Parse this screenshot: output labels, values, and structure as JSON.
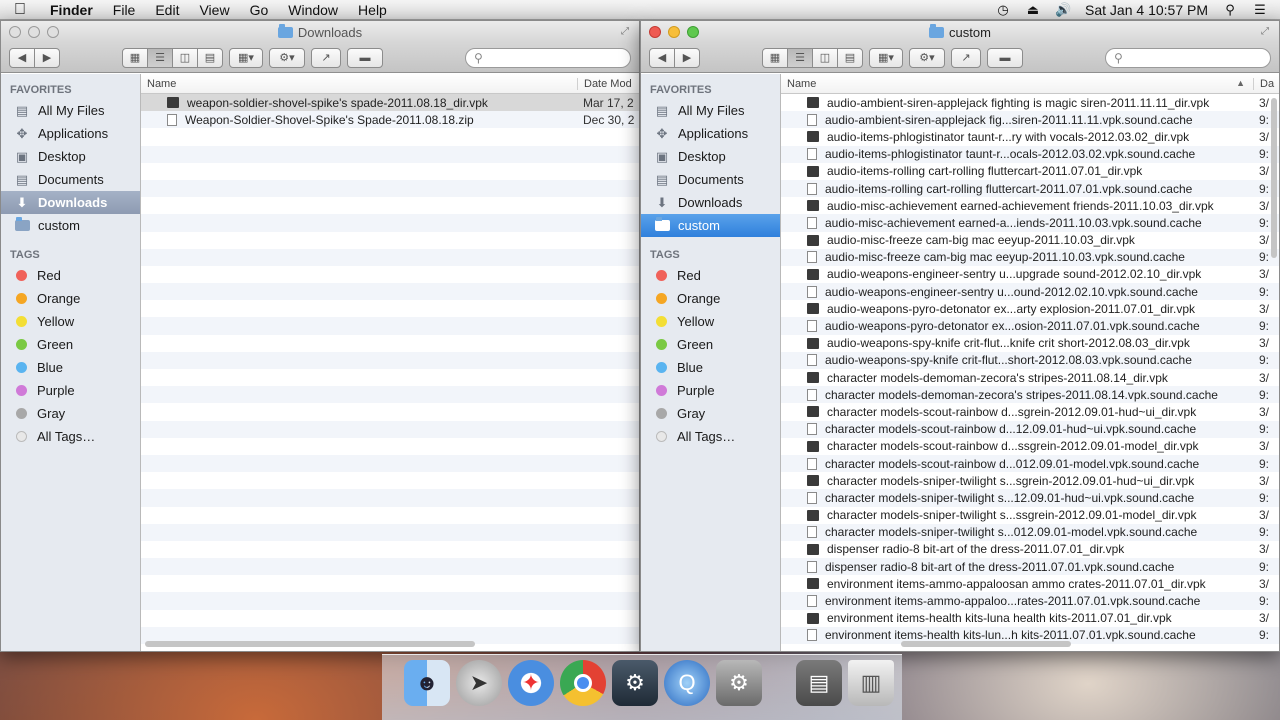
{
  "menubar": {
    "app": "Finder",
    "items": [
      "File",
      "Edit",
      "View",
      "Go",
      "Window",
      "Help"
    ],
    "clock": "Sat Jan 4  10:57 PM"
  },
  "left_window": {
    "title": "Downloads",
    "columns": {
      "name": "Name",
      "date": "Date Mod"
    },
    "sidebar": {
      "favorites_header": "FAVORITES",
      "favorites": [
        {
          "label": "All My Files",
          "icon": "all-files-icon"
        },
        {
          "label": "Applications",
          "icon": "applications-icon"
        },
        {
          "label": "Desktop",
          "icon": "desktop-icon"
        },
        {
          "label": "Documents",
          "icon": "documents-icon"
        },
        {
          "label": "Downloads",
          "icon": "downloads-icon"
        },
        {
          "label": "custom",
          "icon": "folder-icon"
        }
      ],
      "tags_header": "TAGS",
      "tags": [
        {
          "label": "Red",
          "color": "#f0625a"
        },
        {
          "label": "Orange",
          "color": "#f5a623"
        },
        {
          "label": "Yellow",
          "color": "#f3de35"
        },
        {
          "label": "Green",
          "color": "#7ac943"
        },
        {
          "label": "Blue",
          "color": "#5ab4f0"
        },
        {
          "label": "Purple",
          "color": "#d07ad8"
        },
        {
          "label": "Gray",
          "color": "#a8a8a8"
        },
        {
          "label": "All Tags…",
          "color": "#e8e8e8"
        }
      ]
    },
    "files": [
      {
        "name": "weapon-soldier-shovel-spike's spade-2011.08.18_dir.vpk",
        "date": "Mar 17, 2",
        "type": "vpk"
      },
      {
        "name": "Weapon-Soldier-Shovel-Spike's Spade-2011.08.18.zip",
        "date": "Dec 30, 2",
        "type": "doc"
      }
    ]
  },
  "right_window": {
    "title": "custom",
    "columns": {
      "name": "Name",
      "date": "Da"
    },
    "sidebar": {
      "favorites_header": "FAVORITES",
      "favorites": [
        {
          "label": "All My Files",
          "icon": "all-files-icon"
        },
        {
          "label": "Applications",
          "icon": "applications-icon"
        },
        {
          "label": "Desktop",
          "icon": "desktop-icon"
        },
        {
          "label": "Documents",
          "icon": "documents-icon"
        },
        {
          "label": "Downloads",
          "icon": "downloads-icon"
        },
        {
          "label": "custom",
          "icon": "folder-icon"
        }
      ],
      "tags_header": "TAGS",
      "tags": [
        {
          "label": "Red",
          "color": "#f0625a"
        },
        {
          "label": "Orange",
          "color": "#f5a623"
        },
        {
          "label": "Yellow",
          "color": "#f3de35"
        },
        {
          "label": "Green",
          "color": "#7ac943"
        },
        {
          "label": "Blue",
          "color": "#5ab4f0"
        },
        {
          "label": "Purple",
          "color": "#d07ad8"
        },
        {
          "label": "Gray",
          "color": "#a8a8a8"
        },
        {
          "label": "All Tags…",
          "color": "#e8e8e8"
        }
      ]
    },
    "files": [
      {
        "name": "audio-ambient-siren-applejack fighting is magic siren-2011.11.11_dir.vpk",
        "date": "3/",
        "type": "vpk"
      },
      {
        "name": "audio-ambient-siren-applejack fig...siren-2011.11.11.vpk.sound.cache",
        "date": "9:",
        "type": "doc"
      },
      {
        "name": "audio-items-phlogistinator taunt-r...ry with vocals-2012.03.02_dir.vpk",
        "date": "3/",
        "type": "vpk"
      },
      {
        "name": "audio-items-phlogistinator taunt-r...ocals-2012.03.02.vpk.sound.cache",
        "date": "9:",
        "type": "doc"
      },
      {
        "name": "audio-items-rolling cart-rolling fluttercart-2011.07.01_dir.vpk",
        "date": "3/",
        "type": "vpk"
      },
      {
        "name": "audio-items-rolling cart-rolling fluttercart-2011.07.01.vpk.sound.cache",
        "date": "9:",
        "type": "doc"
      },
      {
        "name": "audio-misc-achievement earned-achievement friends-2011.10.03_dir.vpk",
        "date": "3/",
        "type": "vpk"
      },
      {
        "name": "audio-misc-achievement earned-a...iends-2011.10.03.vpk.sound.cache",
        "date": "9:",
        "type": "doc"
      },
      {
        "name": "audio-misc-freeze cam-big mac eeyup-2011.10.03_dir.vpk",
        "date": "3/",
        "type": "vpk"
      },
      {
        "name": "audio-misc-freeze cam-big mac eeyup-2011.10.03.vpk.sound.cache",
        "date": "9:",
        "type": "doc"
      },
      {
        "name": "audio-weapons-engineer-sentry u...upgrade sound-2012.02.10_dir.vpk",
        "date": "3/",
        "type": "vpk"
      },
      {
        "name": "audio-weapons-engineer-sentry u...ound-2012.02.10.vpk.sound.cache",
        "date": "9:",
        "type": "doc"
      },
      {
        "name": "audio-weapons-pyro-detonator ex...arty explosion-2011.07.01_dir.vpk",
        "date": "3/",
        "type": "vpk"
      },
      {
        "name": "audio-weapons-pyro-detonator ex...osion-2011.07.01.vpk.sound.cache",
        "date": "9:",
        "type": "doc"
      },
      {
        "name": "audio-weapons-spy-knife crit-flut...knife crit short-2012.08.03_dir.vpk",
        "date": "3/",
        "type": "vpk"
      },
      {
        "name": "audio-weapons-spy-knife crit-flut...short-2012.08.03.vpk.sound.cache",
        "date": "9:",
        "type": "doc"
      },
      {
        "name": "character models-demoman-zecora's stripes-2011.08.14_dir.vpk",
        "date": "3/",
        "type": "vpk"
      },
      {
        "name": "character models-demoman-zecora's stripes-2011.08.14.vpk.sound.cache",
        "date": "9:",
        "type": "doc"
      },
      {
        "name": "character models-scout-rainbow d...sgrein-2012.09.01-hud~ui_dir.vpk",
        "date": "3/",
        "type": "vpk"
      },
      {
        "name": "character models-scout-rainbow d...12.09.01-hud~ui.vpk.sound.cache",
        "date": "9:",
        "type": "doc"
      },
      {
        "name": "character models-scout-rainbow d...ssgrein-2012.09.01-model_dir.vpk",
        "date": "3/",
        "type": "vpk"
      },
      {
        "name": "character models-scout-rainbow d...012.09.01-model.vpk.sound.cache",
        "date": "9:",
        "type": "doc"
      },
      {
        "name": "character models-sniper-twilight s...sgrein-2012.09.01-hud~ui_dir.vpk",
        "date": "3/",
        "type": "vpk"
      },
      {
        "name": "character models-sniper-twilight s...12.09.01-hud~ui.vpk.sound.cache",
        "date": "9:",
        "type": "doc"
      },
      {
        "name": "character models-sniper-twilight s...ssgrein-2012.09.01-model_dir.vpk",
        "date": "3/",
        "type": "vpk"
      },
      {
        "name": "character models-sniper-twilight s...012.09.01-model.vpk.sound.cache",
        "date": "9:",
        "type": "doc"
      },
      {
        "name": "dispenser radio-8 bit-art of the dress-2011.07.01_dir.vpk",
        "date": "3/",
        "type": "vpk"
      },
      {
        "name": "dispenser radio-8 bit-art of the dress-2011.07.01.vpk.sound.cache",
        "date": "9:",
        "type": "doc"
      },
      {
        "name": "environment items-ammo-appaloosan ammo crates-2011.07.01_dir.vpk",
        "date": "3/",
        "type": "vpk"
      },
      {
        "name": "environment items-ammo-appaloo...rates-2011.07.01.vpk.sound.cache",
        "date": "9:",
        "type": "doc"
      },
      {
        "name": "environment items-health kits-luna health kits-2011.07.01_dir.vpk",
        "date": "3/",
        "type": "vpk"
      },
      {
        "name": "environment items-health kits-lun...h kits-2011.07.01.vpk.sound.cache",
        "date": "9:",
        "type": "doc"
      }
    ]
  },
  "dock": {
    "items": [
      "finder-icon",
      "launchpad-icon",
      "safari-icon",
      "chrome-icon",
      "steam-icon",
      "quicktime-icon",
      "system-preferences-icon",
      "downloads-stack-icon",
      "trash-icon"
    ]
  }
}
